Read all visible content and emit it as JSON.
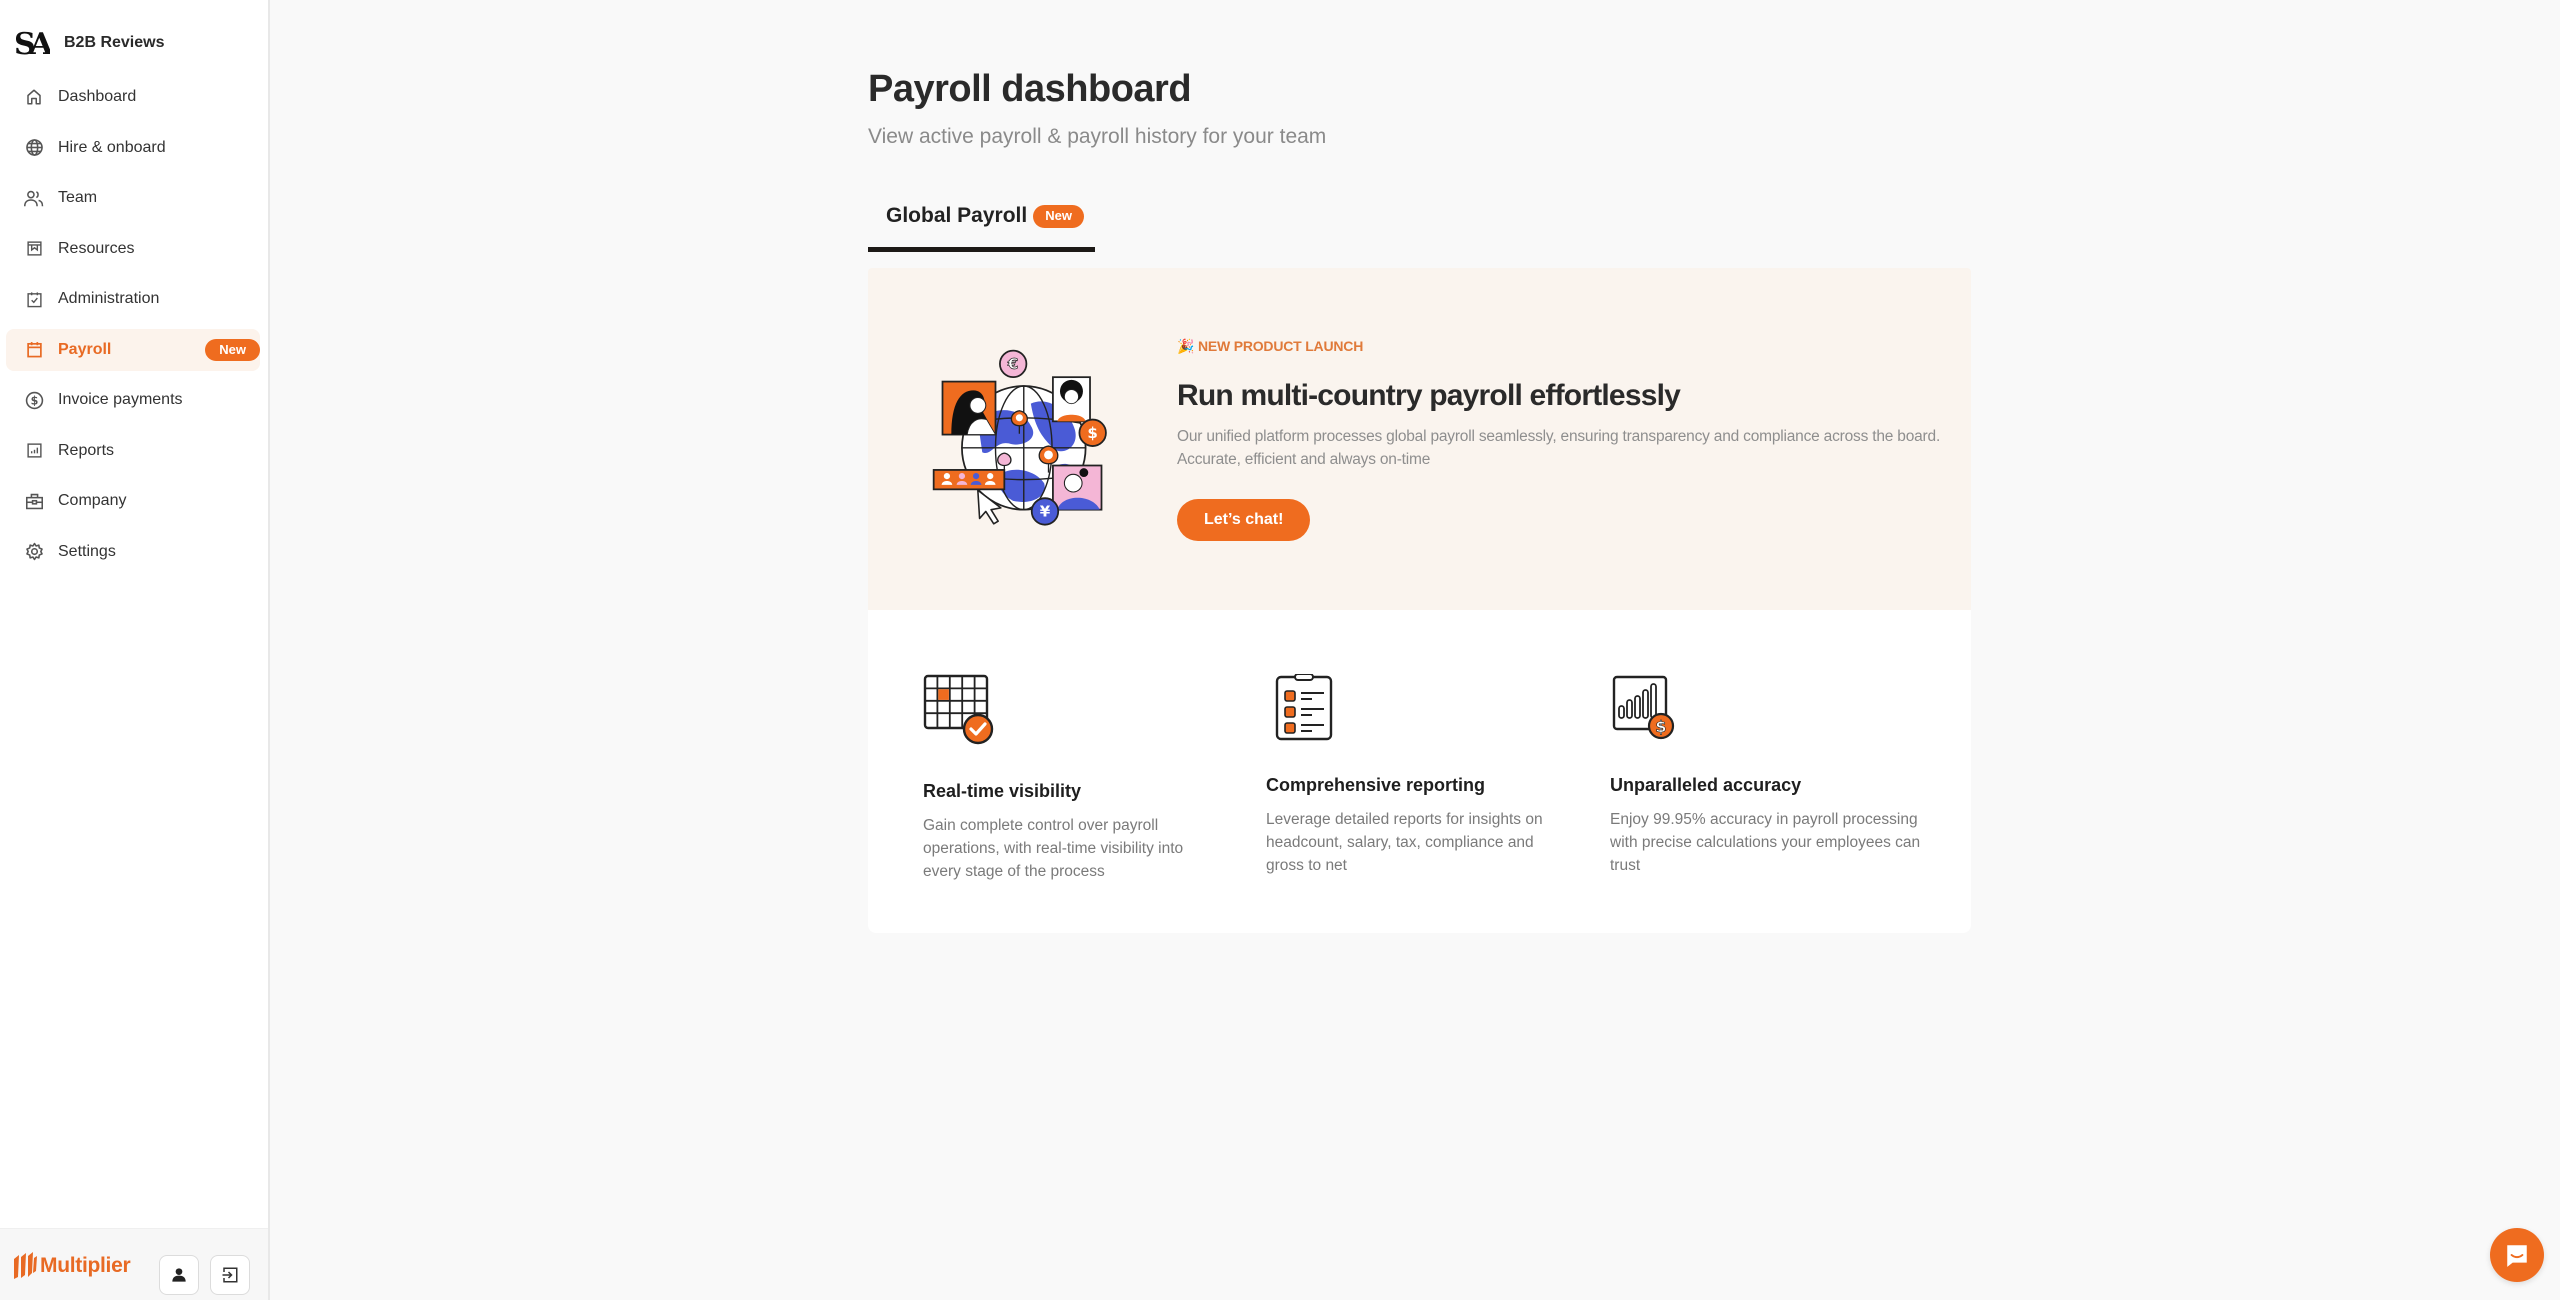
{
  "sidebar": {
    "brand": {
      "name": "B2B Reviews",
      "logo": "SA"
    },
    "items": [
      {
        "label": "Dashboard",
        "icon": "home-icon"
      },
      {
        "label": "Hire & onboard",
        "icon": "globe-icon"
      },
      {
        "label": "Team",
        "icon": "users-icon"
      },
      {
        "label": "Resources",
        "icon": "archive-icon"
      },
      {
        "label": "Administration",
        "icon": "clipboard-check-icon"
      },
      {
        "label": "Payroll",
        "icon": "calendar-icon",
        "active": true,
        "badge": "New"
      },
      {
        "label": "Invoice payments",
        "icon": "dollar-circle-icon"
      },
      {
        "label": "Reports",
        "icon": "bar-chart-icon"
      },
      {
        "label": "Company",
        "icon": "briefcase-icon"
      },
      {
        "label": "Settings",
        "icon": "gear-icon"
      }
    ],
    "footer": {
      "logo_text": "Multiplier",
      "profile_icon": "person-icon",
      "logout_icon": "logout-icon"
    }
  },
  "header": {
    "title": "Payroll dashboard",
    "subtitle": "View active payroll & payroll history for your team"
  },
  "tabs": [
    {
      "label": "Global Payroll",
      "badge": "New",
      "active": true
    }
  ],
  "banner": {
    "eyebrow_emoji": "🎉",
    "eyebrow": "NEW PRODUCT LAUNCH",
    "title": "Run multi-country payroll effortlessly",
    "description": "Our unified platform processes global payroll seamlessly, ensuring transparency and compliance across the board. Accurate, efficient and always on-time",
    "cta_label": "Let’s chat!"
  },
  "features": [
    {
      "title": "Real-time visibility",
      "description": "Gain complete control over payroll operations, with real-time visibility into every stage of the process",
      "icon": "calendar-check-icon"
    },
    {
      "title": "Comprehensive reporting",
      "description": "Leverage detailed reports for insights on headcount, salary, tax, compliance and gross to net",
      "icon": "clipboard-list-icon"
    },
    {
      "title": "Unparalleled accuracy",
      "description": "Enjoy 99.95% accuracy in payroll processing with precise calculations your employees can trust",
      "icon": "chart-dollar-icon"
    }
  ],
  "colors": {
    "accent": "#ef6c1f",
    "banner_bg": "#faf4ee",
    "active_nav_bg": "#fcf3ec"
  }
}
